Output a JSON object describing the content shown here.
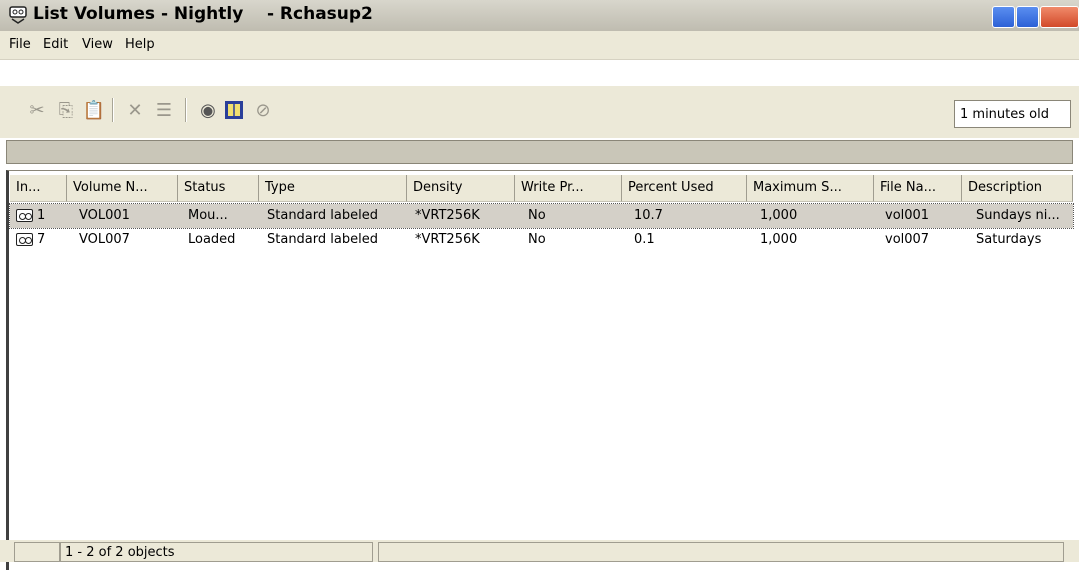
{
  "window": {
    "title": "List Volumes - Nightly    - Rchasup2"
  },
  "menu": {
    "items": [
      "File",
      "Edit",
      "View",
      "Help"
    ]
  },
  "toolbar": {
    "age": "1 minutes old"
  },
  "table": {
    "headers": [
      "In...",
      "Volume N...",
      "Status",
      "Type",
      "Density",
      "Write Pr...",
      "Percent Used",
      "Maximum S...",
      "File Na...",
      "Description"
    ],
    "rows": [
      [
        "1",
        "VOL001",
        "Mou...",
        "Standard labeled",
        "*VRT256K",
        "No",
        "10.7",
        "1,000",
        "vol001",
        "Sundays ni..."
      ],
      [
        "7",
        "VOL007",
        "Loaded",
        "Standard labeled",
        "*VRT256K",
        "No",
        "0.1",
        "1,000",
        "vol007",
        "Saturdays"
      ]
    ]
  },
  "status": {
    "count": "1 - 2 of 2 objects"
  },
  "icons": {
    "app": "tape-volume-icon",
    "cut": "cut-icon",
    "copy": "copy-icon",
    "paste": "paste-icon",
    "delete": "delete-icon",
    "properties": "properties-icon",
    "open": "open-icon",
    "columns": "columns-icon",
    "stop": "stop-icon",
    "row": "tape-icon"
  },
  "colors": {
    "selection": "#d4d0c8",
    "titlebar": "#c8c5ba"
  }
}
